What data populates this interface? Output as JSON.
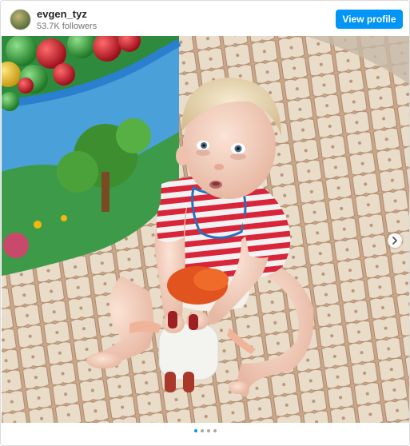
{
  "header": {
    "username": "evgen_tyz",
    "followers": "53.7K followers",
    "view_profile_label": "View profile"
  },
  "post": {
    "carousel_slides": 4,
    "active_slide": 1
  },
  "icons": {
    "avatar": "profile-avatar",
    "next": "chevron-right-icon"
  },
  "colors": {
    "accent": "#0095f6",
    "border": "#dbdbdb",
    "muted": "#737373"
  }
}
